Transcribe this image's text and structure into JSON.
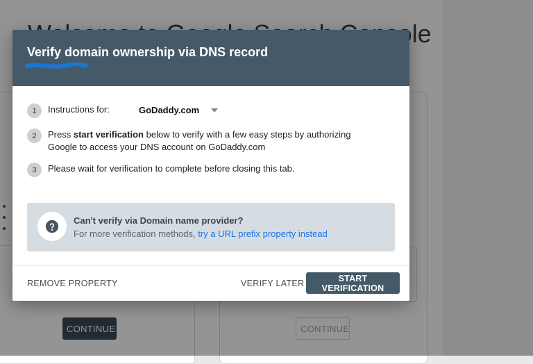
{
  "background": {
    "page_title": "Welcome to Google Search Console",
    "continue_left_label": "CONTINUE",
    "continue_right_label": "CONTINUE"
  },
  "dialog": {
    "title": "Verify domain ownership via DNS record",
    "steps": [
      {
        "num": "1",
        "label": "Instructions for:",
        "provider": "GoDaddy.com"
      },
      {
        "num": "2",
        "prefix": "Press ",
        "bold": "start verification",
        "suffix": " below to verify with a few easy steps by authorizing Google to access your DNS account on GoDaddy.com"
      },
      {
        "num": "3",
        "text": "Please wait for verification to complete before closing this tab."
      }
    ],
    "help": {
      "title": "Can't verify via Domain name provider?",
      "text": "For more verification methods, ",
      "link": "try a URL prefix property instead"
    },
    "buttons": {
      "remove": "REMOVE PROPERTY",
      "later": "VERIFY LATER",
      "start": "START VERIFICATION"
    }
  },
  "colors": {
    "header": "#455a69",
    "primary_button": "#455a69",
    "help_box": "#d6dde2",
    "link": "#1a73e8",
    "redaction": "#1976d2"
  },
  "icons": {
    "help": "question-circle-icon",
    "dropdown": "caret-down-icon"
  }
}
